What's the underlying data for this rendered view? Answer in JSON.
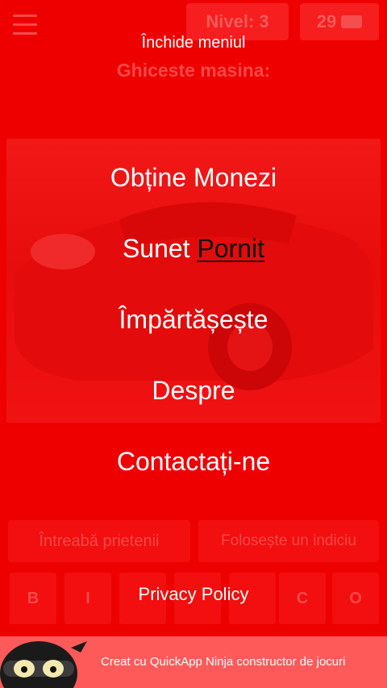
{
  "game": {
    "level_label": "Nivel: 3",
    "coins": "29",
    "prompt": "Ghiceste masina:",
    "buttons": {
      "ask_friends": "Întreabă prietenii",
      "use_hint": "Folosește un indiciu"
    },
    "letters_visible": [
      "B",
      "I",
      "C",
      "O"
    ]
  },
  "menu": {
    "close_label": "Închide meniul",
    "items": {
      "get_coins": "Obține Monezi",
      "sound_label": "Sunet",
      "sound_state": "Pornit",
      "share": "Împărtășește",
      "about": "Despre",
      "contact": "Contactați-ne"
    },
    "privacy": "Privacy Policy"
  },
  "footer": {
    "text": "Creat cu QuickApp Ninja constructor de jocuri"
  },
  "icons": {
    "menu": "hamburger-icon",
    "coins": "coin-stack-icon",
    "brand": "ninja-mascot-icon"
  },
  "colors": {
    "background": "#ee0000",
    "footer": "#ff5a5a",
    "sound_state": "#111111"
  }
}
